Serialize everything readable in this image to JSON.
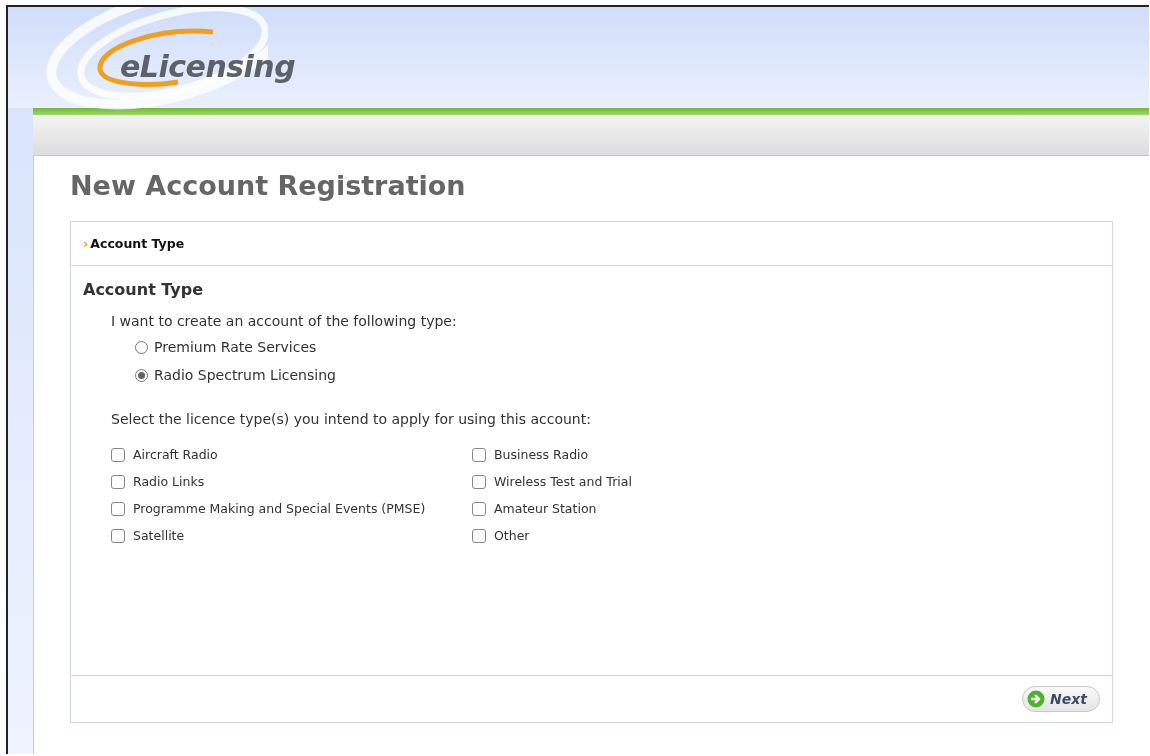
{
  "header": {
    "logo_text": "eLicensing"
  },
  "page_title": "New Account Registration",
  "breadcrumb": {
    "icon": "›",
    "label": "Account Type"
  },
  "section": {
    "title": "Account Type",
    "account_prompt": "I want to create an account of the following type:",
    "account_types": [
      {
        "label": "Premium Rate Services",
        "selected": false
      },
      {
        "label": "Radio Spectrum Licensing",
        "selected": true
      }
    ],
    "licence_prompt": "Select the licence type(s) you intend to apply for using this account:",
    "licence_types": [
      {
        "label": "Aircraft Radio",
        "checked": false
      },
      {
        "label": "Business Radio",
        "checked": false
      },
      {
        "label": "Radio Links",
        "checked": false
      },
      {
        "label": "Wireless Test and Trial",
        "checked": false
      },
      {
        "label": "Programme Making and Special Events (PMSE)",
        "checked": false
      },
      {
        "label": "Amateur Station",
        "checked": false
      },
      {
        "label": "Satellite",
        "checked": false
      },
      {
        "label": "Other",
        "checked": false
      }
    ]
  },
  "next_button": "Next"
}
